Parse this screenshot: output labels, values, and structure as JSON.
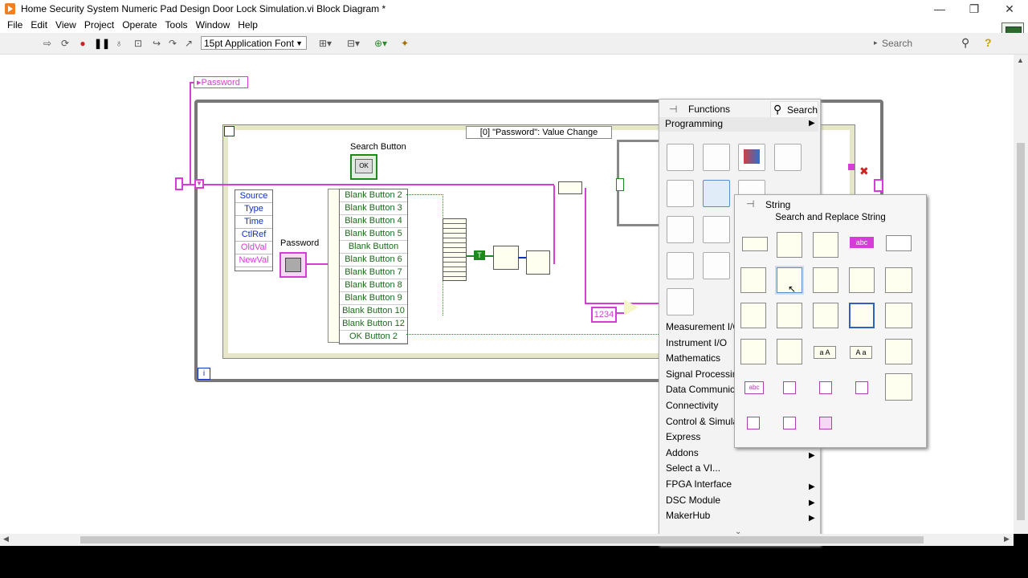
{
  "window": {
    "title": "Home Security System Numeric Pad Design Door Lock Simulation.vi Block Diagram *",
    "controls": {
      "minimize": "—",
      "restore": "❐",
      "close": "✕"
    }
  },
  "menu": [
    "File",
    "Edit",
    "View",
    "Project",
    "Operate",
    "Tools",
    "Window",
    "Help"
  ],
  "toolbar": {
    "font": "15pt Application Font",
    "search_placeholder": "Search",
    "help": "?"
  },
  "diagram": {
    "password_local": "Password",
    "event_case": "[0] \"Password\": Value Change",
    "search_button_label": "Search Button",
    "search_button_text": "OK",
    "password_label": "Password",
    "event_data": [
      "Source",
      "Type",
      "Time",
      "CtlRef",
      "OldVal",
      "NewVal"
    ],
    "buttons": [
      "Blank Button 2",
      "Blank Button 3",
      "Blank Button 4",
      "Blank Button 5",
      "Blank Button",
      "Blank Button 6",
      "Blank Button 7",
      "Blank Button 8",
      "Blank Button 9",
      "Blank Button 10",
      "Blank Button 12",
      "OK Button 2"
    ],
    "constant": "1234",
    "bool_const": "T",
    "info_icon": "i"
  },
  "functions_palette": {
    "title": "Functions",
    "search": "Search",
    "category": "Programming",
    "items": [
      {
        "label": "Measurement I/O",
        "arrow": false
      },
      {
        "label": "Instrument I/O",
        "arrow": false
      },
      {
        "label": "Mathematics",
        "arrow": false
      },
      {
        "label": "Signal Processing",
        "arrow": false
      },
      {
        "label": "Data Communica",
        "arrow": false
      },
      {
        "label": "Connectivity",
        "arrow": false
      },
      {
        "label": "Control & Simula",
        "arrow": false
      },
      {
        "label": "Express",
        "arrow": false
      },
      {
        "label": "Addons",
        "arrow": true
      },
      {
        "label": "Select a VI...",
        "arrow": false
      },
      {
        "label": "FPGA Interface",
        "arrow": true
      },
      {
        "label": "DSC Module",
        "arrow": true
      },
      {
        "label": "MakerHub",
        "arrow": true
      }
    ]
  },
  "string_palette": {
    "title": "String",
    "hover_label": "Search and Replace String"
  },
  "colors": {
    "wire_pink": "#d63cd6",
    "wire_green": "#1a8a1a",
    "enum_blue": "#1030c0"
  }
}
